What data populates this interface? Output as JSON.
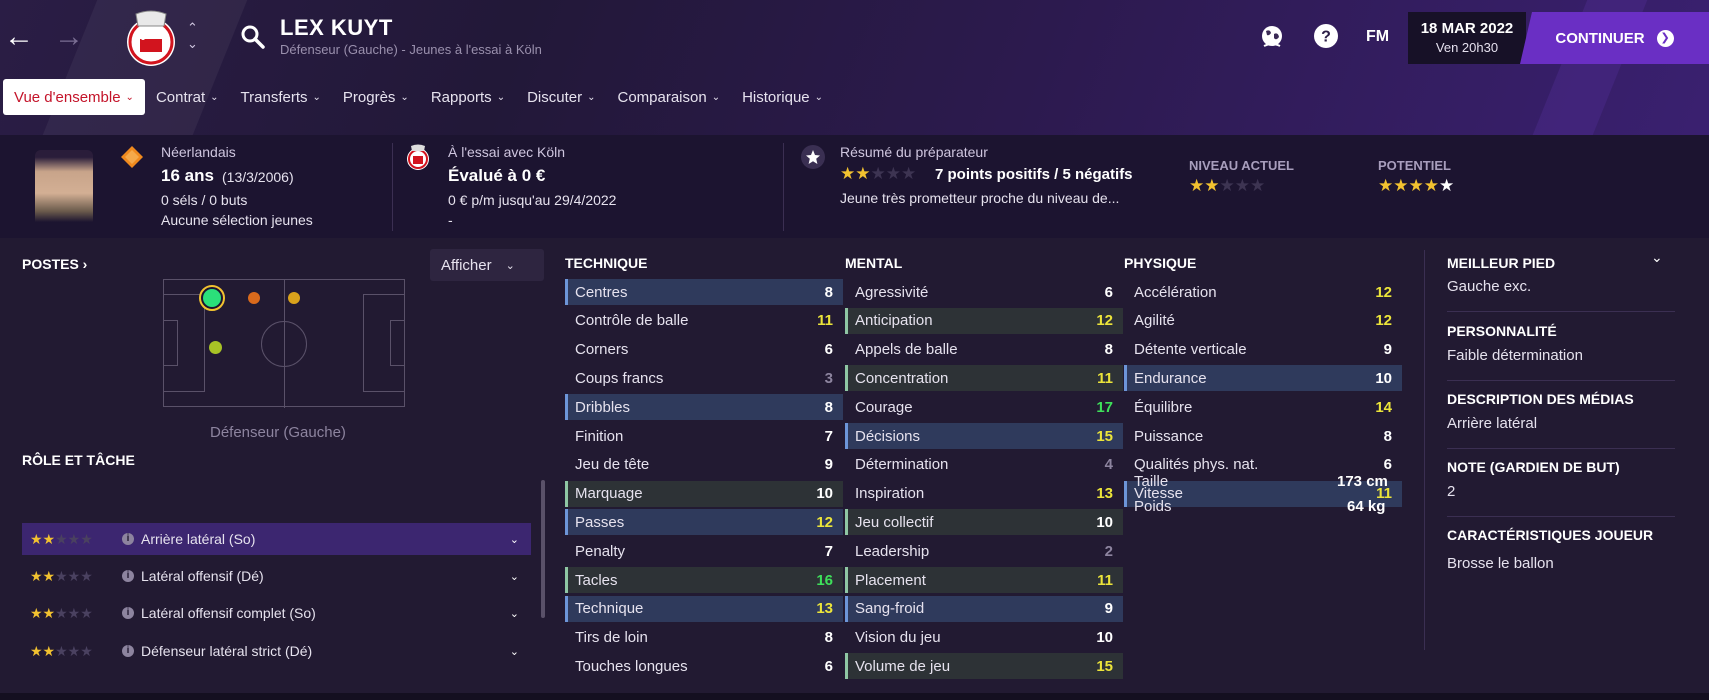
{
  "header": {
    "player_name": "LEX KUYT",
    "subtitle": "Défenseur (Gauche) - Jeunes à l'essai à Köln",
    "date": "18 MAR 2022",
    "time": "Ven 20h30",
    "continue_label": "CONTINUER",
    "fm_label": "FM",
    "help_label": "?"
  },
  "tabs": [
    {
      "label": "Vue d'ensemble",
      "active": true
    },
    {
      "label": "Contrat"
    },
    {
      "label": "Transferts"
    },
    {
      "label": "Progrès"
    },
    {
      "label": "Rapports"
    },
    {
      "label": "Discuter"
    },
    {
      "label": "Comparaison"
    },
    {
      "label": "Historique"
    }
  ],
  "info": {
    "nationality": "Néerlandais",
    "age": "16 ans",
    "dob": "(13/3/2006)",
    "caps": "0 séls / 0 buts",
    "youth_caps": "Aucune sélection jeunes",
    "trial_club": "À l'essai avec Köln",
    "value": "Évalué à 0 €",
    "wage": "0 € p/m jusqu'au 29/4/2022",
    "dash": "-",
    "coach_title": "Résumé du préparateur",
    "coach_stars": 2,
    "coach_points": "7 points positifs / 5 négatifs",
    "coach_desc": "Jeune très prometteur proche du niveau de...",
    "current_label": "NIVEAU ACTUEL",
    "current_stars": 2,
    "potential_label": "POTENTIEL",
    "potential_stars": 4.5
  },
  "positions": {
    "title": "POSTES",
    "show_label": "Afficher",
    "caption": "Défenseur (Gauche)"
  },
  "roles": {
    "title": "RÔLE ET TÂCHE",
    "items": [
      {
        "stars": 2,
        "label": "Arrière latéral (So)",
        "selected": true
      },
      {
        "stars": 2,
        "label": "Latéral offensif (Dé)"
      },
      {
        "stars": 2,
        "label": "Latéral offensif complet (So)"
      },
      {
        "stars": 2,
        "label": "Défenseur latéral strict (Dé)"
      }
    ]
  },
  "technique": {
    "title": "TECHNIQUE",
    "rows": [
      {
        "name": "Centres",
        "value": "8",
        "hl": "b",
        "c": "w"
      },
      {
        "name": "Contrôle de balle",
        "value": "11",
        "c": "y"
      },
      {
        "name": "Corners",
        "value": "6",
        "c": "w"
      },
      {
        "name": "Coups francs",
        "value": "3",
        "c": "dim"
      },
      {
        "name": "Dribbles",
        "value": "8",
        "hl": "b",
        "c": "w"
      },
      {
        "name": "Finition",
        "value": "7",
        "c": "w"
      },
      {
        "name": "Jeu de tête",
        "value": "9",
        "c": "w"
      },
      {
        "name": "Marquage",
        "value": "10",
        "hl": "g",
        "c": "w"
      },
      {
        "name": "Passes",
        "value": "12",
        "hl": "b",
        "c": "y"
      },
      {
        "name": "Penalty",
        "value": "7",
        "c": "w"
      },
      {
        "name": "Tacles",
        "value": "16",
        "hl": "g",
        "c": "gr"
      },
      {
        "name": "Technique",
        "value": "13",
        "hl": "b",
        "c": "y"
      },
      {
        "name": "Tirs de loin",
        "value": "8",
        "c": "w"
      },
      {
        "name": "Touches longues",
        "value": "6",
        "c": "w"
      }
    ]
  },
  "mental": {
    "title": "MENTAL",
    "rows": [
      {
        "name": "Agressivité",
        "value": "6",
        "c": "w"
      },
      {
        "name": "Anticipation",
        "value": "12",
        "hl": "g",
        "c": "y"
      },
      {
        "name": "Appels de balle",
        "value": "8",
        "c": "w"
      },
      {
        "name": "Concentration",
        "value": "11",
        "hl": "g",
        "c": "y"
      },
      {
        "name": "Courage",
        "value": "17",
        "c": "gr"
      },
      {
        "name": "Décisions",
        "value": "15",
        "hl": "b",
        "c": "y"
      },
      {
        "name": "Détermination",
        "value": "4",
        "c": "dim"
      },
      {
        "name": "Inspiration",
        "value": "13",
        "c": "y"
      },
      {
        "name": "Jeu collectif",
        "value": "10",
        "hl": "g",
        "c": "w"
      },
      {
        "name": "Leadership",
        "value": "2",
        "c": "dim"
      },
      {
        "name": "Placement",
        "value": "11",
        "hl": "g",
        "c": "y"
      },
      {
        "name": "Sang-froid",
        "value": "9",
        "hl": "b",
        "c": "w"
      },
      {
        "name": "Vision du jeu",
        "value": "10",
        "c": "w"
      },
      {
        "name": "Volume de jeu",
        "value": "15",
        "hl": "g",
        "c": "y"
      }
    ]
  },
  "physique": {
    "title": "PHYSIQUE",
    "rows": [
      {
        "name": "Accélération",
        "value": "12",
        "c": "y"
      },
      {
        "name": "Agilité",
        "value": "12",
        "c": "y"
      },
      {
        "name": "Détente verticale",
        "value": "9",
        "c": "w"
      },
      {
        "name": "Endurance",
        "value": "10",
        "hl": "b",
        "c": "w"
      },
      {
        "name": "Équilibre",
        "value": "14",
        "c": "y"
      },
      {
        "name": "Puissance",
        "value": "8",
        "c": "w"
      },
      {
        "name": "Qualités phys. nat.",
        "value": "6",
        "c": "w"
      },
      {
        "name": "Vitesse",
        "value": "11",
        "hl": "b",
        "c": "y"
      }
    ],
    "height_label": "Taille",
    "height": "173 cm",
    "weight_label": "Poids",
    "weight": "64 kg"
  },
  "side": {
    "foot_title": "MEILLEUR PIED",
    "foot": "Gauche exc.",
    "pers_title": "PERSONNALITÉ",
    "pers": "Faible détermination",
    "media_title": "DESCRIPTION DES MÉDIAS",
    "media": "Arrière latéral",
    "gk_title": "NOTE (GARDIEN DE BUT)",
    "gk": "2",
    "traits_title": "CARACTÉRISTIQUES JOUEUR",
    "traits": "Brosse le ballon"
  }
}
